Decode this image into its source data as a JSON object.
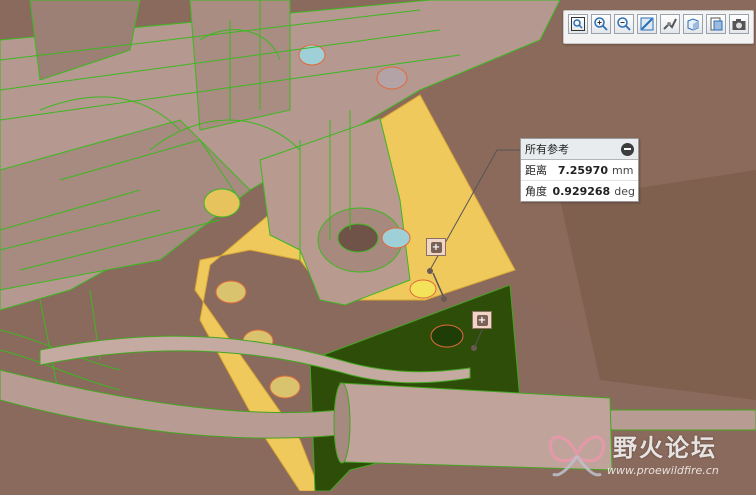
{
  "toolbar": {
    "tools": [
      {
        "icon": "zoom-fit-icon"
      },
      {
        "icon": "zoom-in-icon"
      },
      {
        "icon": "zoom-out-icon"
      },
      {
        "icon": "repaint-icon"
      },
      {
        "icon": "display-style-icon"
      },
      {
        "icon": "view-orientation-icon"
      },
      {
        "icon": "saved-views-icon"
      },
      {
        "icon": "camera-icon"
      }
    ]
  },
  "measure_panel": {
    "title": "所有参考",
    "rows": [
      {
        "label": "距离",
        "value": "7.25970",
        "unit": "mm"
      },
      {
        "label": "角度",
        "value": "0.929268",
        "unit": "deg"
      }
    ]
  },
  "markers": [
    {
      "symbol": "+"
    },
    {
      "symbol": "+"
    }
  ],
  "watermark": {
    "name": "野火论坛",
    "url": "www.proewildfire.cn"
  },
  "colors": {
    "background": "#8a6a5c",
    "part_surface": "#b49589",
    "highlight_face": "#f3c75a",
    "dark_face": "#2f4f0a",
    "edge_lines": "#33cc1a",
    "selected_hole": "#9fd0d8"
  }
}
